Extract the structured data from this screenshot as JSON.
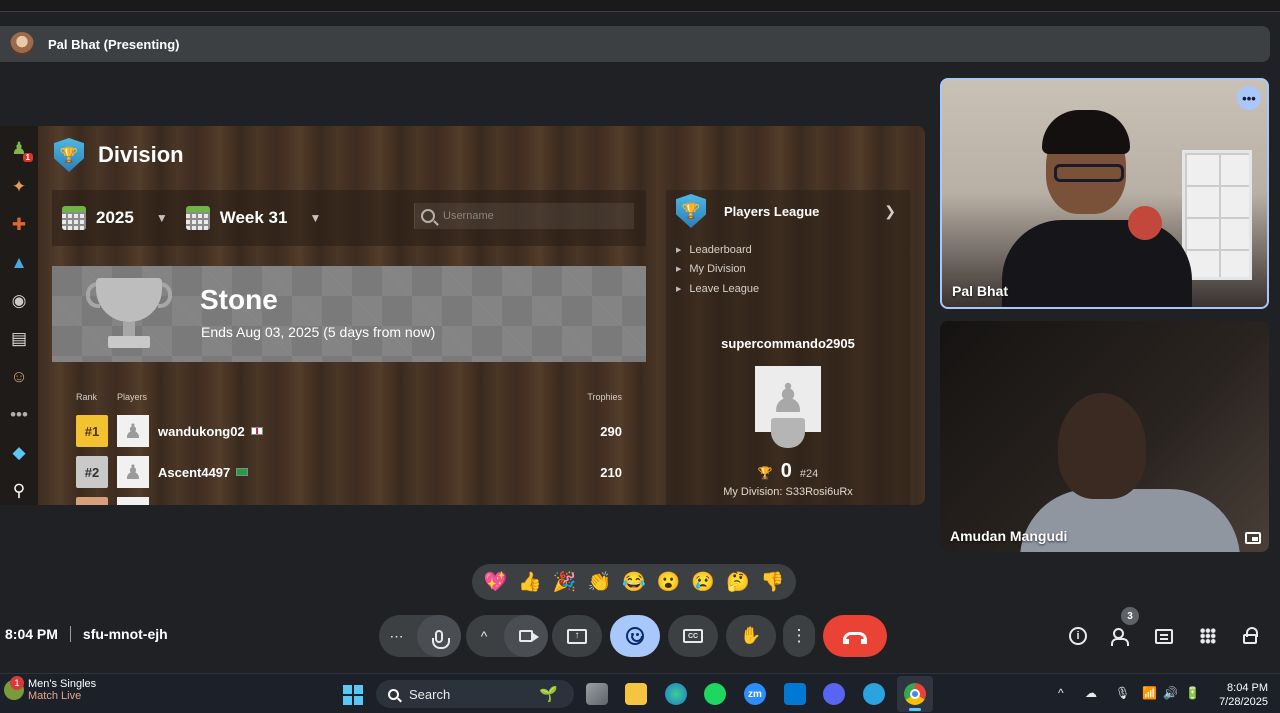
{
  "meeting": {
    "presenter_label": "Pal Bhat (Presenting)",
    "time": "8:04 PM",
    "code": "sfu-mnot-ejh",
    "participants_count": "3"
  },
  "chess": {
    "section_title": "Division",
    "sidebar_badge": "1",
    "sidebar_icons": [
      "play-icon",
      "puzzles-icon",
      "lessons-icon",
      "learn-icon",
      "watch-icon",
      "news-icon",
      "social-icon",
      "more-icon",
      "premium-icon",
      "search-icon"
    ],
    "year": "2025",
    "week": "Week 31",
    "search_placeholder": "Username",
    "league": {
      "name": "Stone",
      "ends": "Ends Aug 03, 2025 (5 days from now)"
    },
    "table": {
      "headers": {
        "rank": "Rank",
        "players": "Players",
        "trophies": "Trophies"
      },
      "rows": [
        {
          "rank": "#1",
          "name": "wandukong02",
          "trophies": "290",
          "rank_color": "#f2c230",
          "flag": "kr"
        },
        {
          "rank": "#2",
          "name": "Ascent4497",
          "trophies": "210",
          "rank_color": "#c9c9c9",
          "flag": "br"
        }
      ]
    },
    "players_league": {
      "title": "Players League",
      "links": [
        "Leaderboard",
        "My Division",
        "Leave League"
      ],
      "username": "supercommando2905",
      "score": "0",
      "position": "#24",
      "my_division": "My Division: S33Rosi6uRx"
    }
  },
  "tiles": [
    {
      "name": "Pal Bhat"
    },
    {
      "name": "Amudan Mangudi"
    }
  ],
  "reactions": [
    "💖",
    "👍",
    "🎉",
    "👏",
    "😂",
    "😮",
    "😢",
    "🤔",
    "👎"
  ],
  "controls": {
    "more_options_glyph": "⋯",
    "caret_glyph": "^",
    "overflow_glyph": "⋮"
  },
  "taskbar": {
    "widget_title": "Men's Singles",
    "widget_subtitle": "Match Live",
    "widget_badge": "1",
    "search_label": "Search",
    "apps": [
      "file-explorer",
      "folder",
      "edge",
      "spotify",
      "zoom",
      "vscode",
      "discord",
      "telegram",
      "chrome"
    ],
    "zoom_label": "zm",
    "tray_time": "8:04 PM",
    "tray_date": "7/28/2025"
  },
  "colors": {
    "accent_blue": "#a8c7fa",
    "hangup_red": "#ea4335",
    "meet_bg": "#202124"
  }
}
